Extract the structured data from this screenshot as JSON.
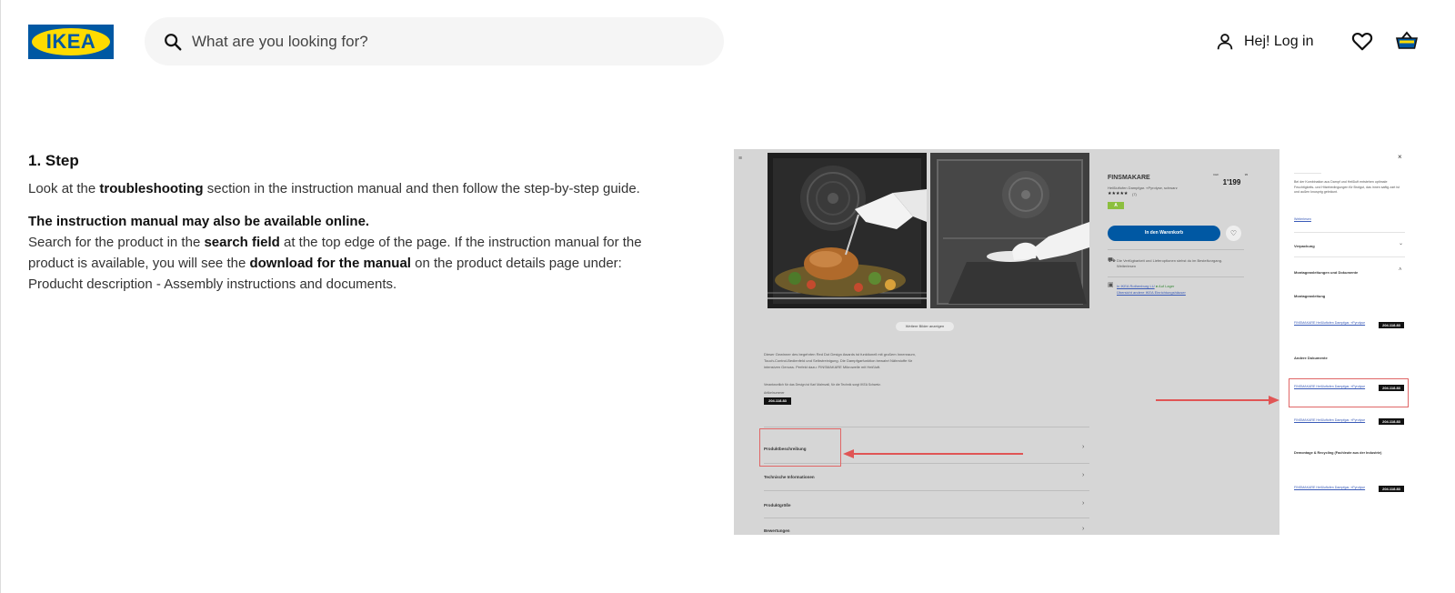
{
  "header": {
    "logo_text": "IKEA",
    "search_placeholder": "What are you looking for?",
    "login_label": "Hej! Log in",
    "icons": [
      "search-icon",
      "user-icon",
      "heart-icon",
      "basket-icon"
    ],
    "brand_colors": {
      "blue": "#0058a3",
      "yellow": "#ffdb00"
    }
  },
  "step": {
    "title": "1. Step",
    "p1_a": "Look at the ",
    "p1_b": "troubleshooting",
    "p1_c": " section in the instruction manual and then follow the step-by-step guide.",
    "p2_bold": "The instruction manual may also be available online.",
    "p3_a": "Search for the product in the ",
    "p3_b": "search field",
    "p3_c": " at the top edge of the page. If the instruction manual for the product is available, you will see the ",
    "p3_d": "download for the manual",
    "p3_e": " on the product details page under:",
    "p4": "Producht description - Assembly instructions and documents."
  },
  "screenshot": {
    "product_name": "FINSMAKARE",
    "product_sub": "Heißluftofen Dampfgar. «Pyrolyse, schwarz",
    "price_prefix": "CHF",
    "price_value": "1'199",
    "price_suffix": "95",
    "rating": "★★★★★",
    "rating_count": "(7)",
    "energy": "A",
    "cart_button": "In den Warenkorb",
    "delivery_text": "Die Verfügbarkeit und Lieferoptionen siehst du im Bestellvorgang. Weiterlesen",
    "store_text_a": "In IKEA Rothenburg LU",
    "store_text_b": "● Auf Lager",
    "store_link": "Übersicht andere IKEA Einrichtungshäuser",
    "more_images": "Weitere Bilder anzeigen",
    "description": "Dieser Gewinner des begehrten Red Dot Design Awards ist funktionell mit großem Innenraum, Touch-Control-Bedienfeld und Selbstreinigung. Die Dampfgarfunktion bewahrt Nährstoffe für intensiven Genuss. Perfekt dazu: FINSMAKARE Mikrowelle mit Heißluft.",
    "designer_text": "Verantwortlich für das Design ist Karl Malmvall, für die Technik sorgt IKEA Schweiz.",
    "article_label": "Artikelnummer",
    "article_number": "204.118.83",
    "accordion": [
      "Produktbeschreibung",
      "Technische Informationen",
      "Produktgröße",
      "Bewertungen"
    ],
    "panel": {
      "intro": "Bei der Kombination aus Dampf und Heißluft entstehen optimale Feuchtigkeits- und Hitzebedingungen für Brotgut, das innen saftig zart ist und außen knusprig gebräunt.",
      "read_more": "Weiterlesen",
      "packaging": "Verpackung",
      "docs_heading": "Montageanleitungen und Dokumente",
      "assembly": "Montageanleitung",
      "doc_link": "FINSMAKARE Heißluftofen Dampfgar. «Pyrolyse",
      "doc_number": "204.118.83",
      "other_docs": "Andere Dokumente",
      "recycling": "Demontage & Recycling (Fachleute aus der Industrie)",
      "close": "×"
    }
  }
}
